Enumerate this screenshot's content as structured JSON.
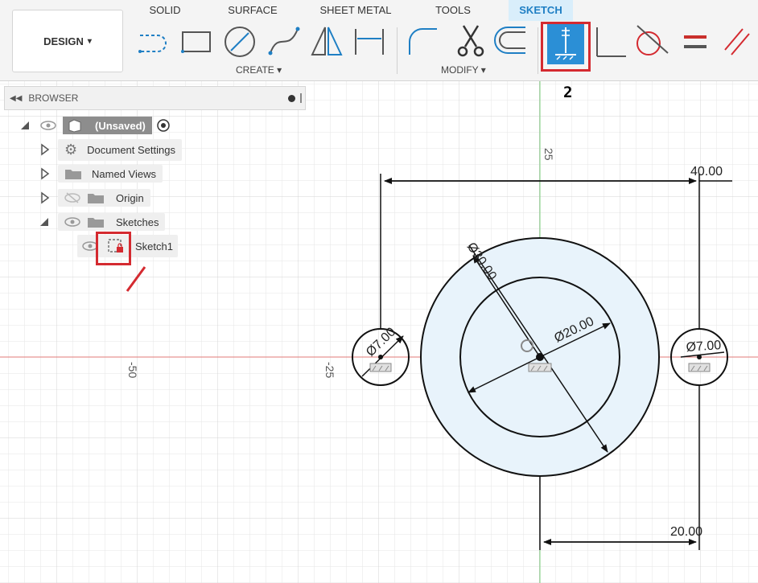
{
  "tabs": {
    "solid": "SOLID",
    "surface": "SURFACE",
    "sheet_metal": "SHEET METAL",
    "tools": "TOOLS",
    "sketch": "SKETCH"
  },
  "design_button": {
    "label": "DESIGN",
    "arrow": "▾"
  },
  "groups": {
    "create": "CREATE ▾",
    "modify": "MODIFY ▾"
  },
  "browser": {
    "title": "BROWSER",
    "root": "(Unsaved)",
    "items": {
      "document_settings": "Document Settings",
      "named_views": "Named Views",
      "origin": "Origin",
      "sketches": "Sketches",
      "sketch1": "Sketch1"
    }
  },
  "annotation_number": "2",
  "axis_labels": {
    "top": "25",
    "left_far": "-50",
    "left_near": "-25"
  },
  "dimensions": {
    "width": "40.00",
    "outer_diameter": "Ø30.00",
    "inner_diameter": "Ø20.00",
    "left_hole": "Ø7.00",
    "right_hole": "Ø7.00",
    "offset": "20.00"
  },
  "colors": {
    "accent": "#1f7fc4",
    "highlight": "#d42a30",
    "fill": "#e8f3fb",
    "axis_red": "#d9534f",
    "axis_green": "#5cb85c"
  }
}
